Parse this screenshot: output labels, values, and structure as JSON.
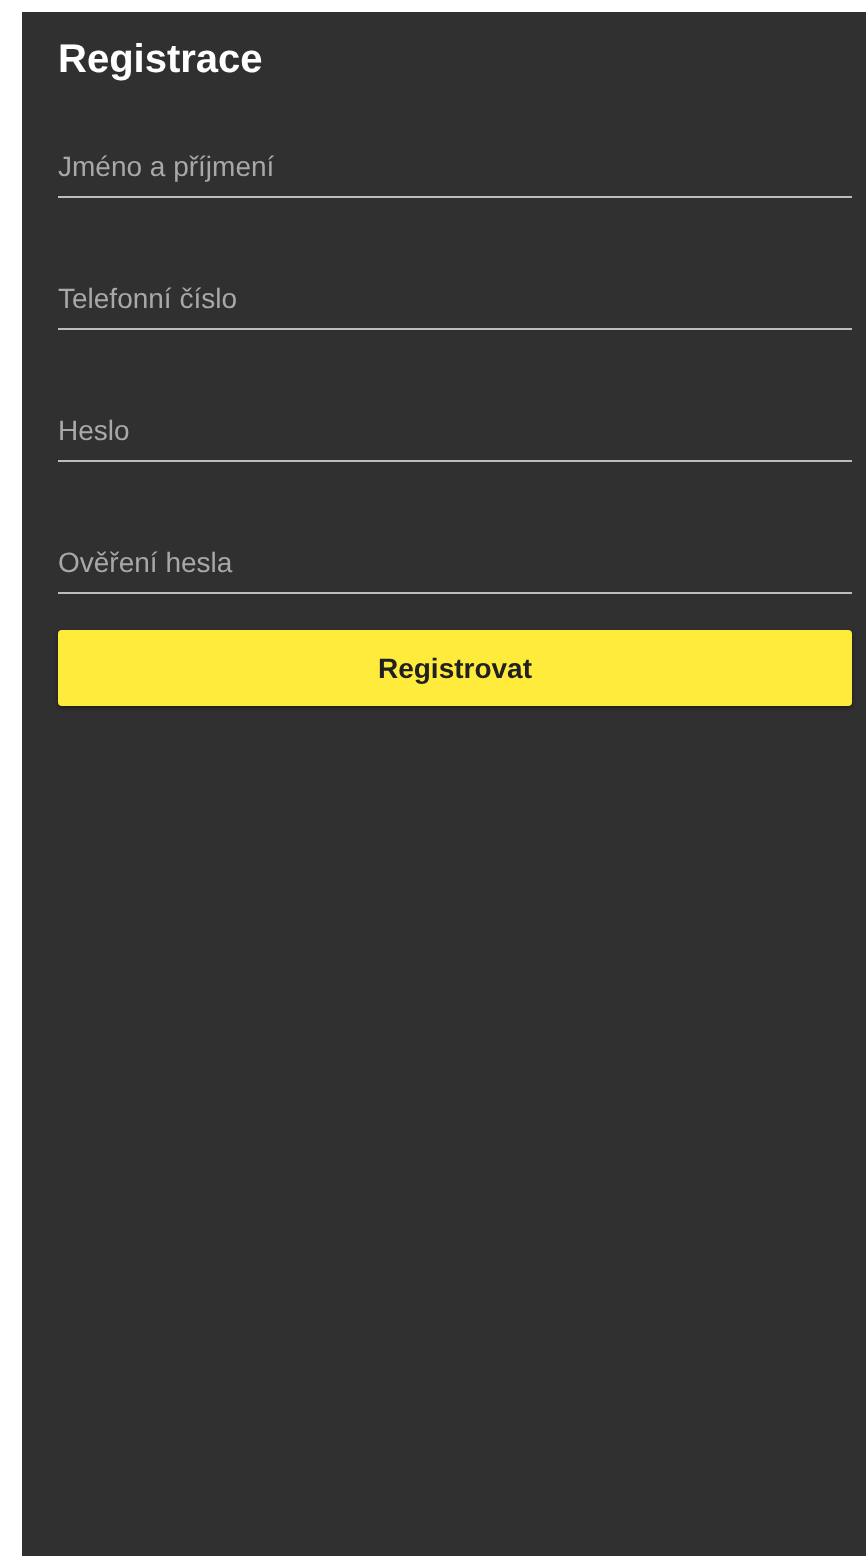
{
  "title": "Registrace",
  "fields": [
    {
      "placeholder": "Jméno a příjmení"
    },
    {
      "placeholder": "Telefonní číslo"
    },
    {
      "placeholder": "Heslo"
    },
    {
      "placeholder": "Ověření hesla"
    }
  ],
  "button": "Registrovat"
}
